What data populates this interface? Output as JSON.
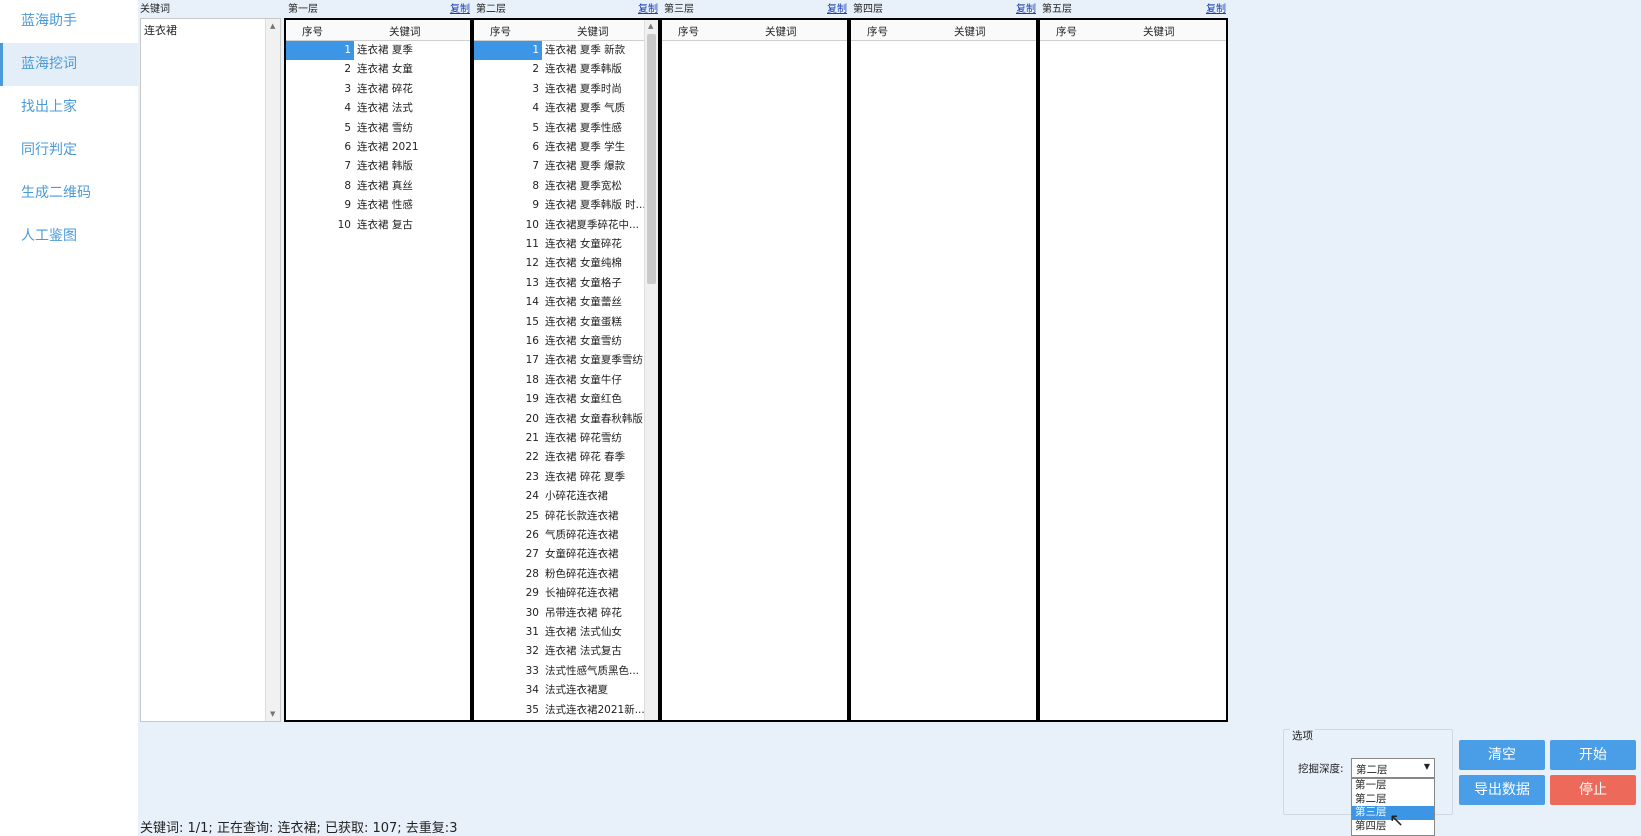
{
  "sidebar": {
    "items": [
      {
        "label": "蓝海助手"
      },
      {
        "label": "蓝海挖词"
      },
      {
        "label": "找出上家"
      },
      {
        "label": "同行判定"
      },
      {
        "label": "生成二维码"
      },
      {
        "label": "人工鉴图"
      }
    ]
  },
  "keyword_box": {
    "title": "关键词",
    "entry": "连衣裙"
  },
  "copy_label": "复制",
  "table_headers": {
    "index": "序号",
    "keyword": "关键词"
  },
  "layers": [
    {
      "title": "第一层",
      "rows": [
        {
          "index": "1",
          "keyword": "连衣裙 夏季",
          "selected": true
        },
        {
          "index": "2",
          "keyword": "连衣裙 女童"
        },
        {
          "index": "3",
          "keyword": "连衣裙 碎花"
        },
        {
          "index": "4",
          "keyword": "连衣裙 法式"
        },
        {
          "index": "5",
          "keyword": "连衣裙 雪纺"
        },
        {
          "index": "6",
          "keyword": "连衣裙 2021"
        },
        {
          "index": "7",
          "keyword": "连衣裙 韩版"
        },
        {
          "index": "8",
          "keyword": "连衣裙 真丝"
        },
        {
          "index": "9",
          "keyword": "连衣裙 性感"
        },
        {
          "index": "10",
          "keyword": "连衣裙 复古"
        }
      ]
    },
    {
      "title": "第二层",
      "rows": [
        {
          "index": "1",
          "keyword": "连衣裙 夏季 新款",
          "selected": true
        },
        {
          "index": "2",
          "keyword": "连衣裙 夏季韩版"
        },
        {
          "index": "3",
          "keyword": "连衣裙 夏季时尚"
        },
        {
          "index": "4",
          "keyword": "连衣裙 夏季 气质"
        },
        {
          "index": "5",
          "keyword": "连衣裙 夏季性感"
        },
        {
          "index": "6",
          "keyword": "连衣裙 夏季 学生"
        },
        {
          "index": "7",
          "keyword": "连衣裙 夏季 爆款"
        },
        {
          "index": "8",
          "keyword": "连衣裙 夏季宽松"
        },
        {
          "index": "9",
          "keyword": "连衣裙 夏季韩版 时..."
        },
        {
          "index": "10",
          "keyword": "连衣裙夏季碎花中..."
        },
        {
          "index": "11",
          "keyword": "连衣裙 女童碎花"
        },
        {
          "index": "12",
          "keyword": "连衣裙 女童纯棉"
        },
        {
          "index": "13",
          "keyword": "连衣裙 女童格子"
        },
        {
          "index": "14",
          "keyword": "连衣裙 女童蕾丝"
        },
        {
          "index": "15",
          "keyword": "连衣裙 女童蛋糕"
        },
        {
          "index": "16",
          "keyword": "连衣裙 女童雪纺"
        },
        {
          "index": "17",
          "keyword": "连衣裙 女童夏季雪纺"
        },
        {
          "index": "18",
          "keyword": "连衣裙 女童牛仔"
        },
        {
          "index": "19",
          "keyword": "连衣裙 女童红色"
        },
        {
          "index": "20",
          "keyword": "连衣裙 女童春秋韩版"
        },
        {
          "index": "21",
          "keyword": "连衣裙 碎花雪纺"
        },
        {
          "index": "22",
          "keyword": "连衣裙 碎花 春季"
        },
        {
          "index": "23",
          "keyword": "连衣裙 碎花 夏季"
        },
        {
          "index": "24",
          "keyword": "小碎花连衣裙"
        },
        {
          "index": "25",
          "keyword": "碎花长款连衣裙"
        },
        {
          "index": "26",
          "keyword": "气质碎花连衣裙"
        },
        {
          "index": "27",
          "keyword": "女童碎花连衣裙"
        },
        {
          "index": "28",
          "keyword": "粉色碎花连衣裙"
        },
        {
          "index": "29",
          "keyword": "长袖碎花连衣裙"
        },
        {
          "index": "30",
          "keyword": "吊带连衣裙 碎花"
        },
        {
          "index": "31",
          "keyword": "连衣裙 法式仙女"
        },
        {
          "index": "32",
          "keyword": "连衣裙 法式复古"
        },
        {
          "index": "33",
          "keyword": "法式性感气质黑色..."
        },
        {
          "index": "34",
          "keyword": "法式连衣裙夏"
        },
        {
          "index": "35",
          "keyword": "法式连衣裙2021新..."
        }
      ]
    },
    {
      "title": "第三层",
      "rows": []
    },
    {
      "title": "第四层",
      "rows": []
    },
    {
      "title": "第五层",
      "rows": []
    }
  ],
  "status": "关键词: 1/1; 正在查询: 连衣裙; 已获取: 107; 去重复:3",
  "options": {
    "legend": "选项",
    "depth_label": "挖掘深度:",
    "depth_selected": "第二层",
    "depth_options": [
      "第一层",
      "第二层",
      "第三层",
      "第四层"
    ],
    "highlighted_option": "第三层"
  },
  "buttons": {
    "clear": "清空",
    "start": "开始",
    "export": "导出数据",
    "stop": "停止"
  }
}
